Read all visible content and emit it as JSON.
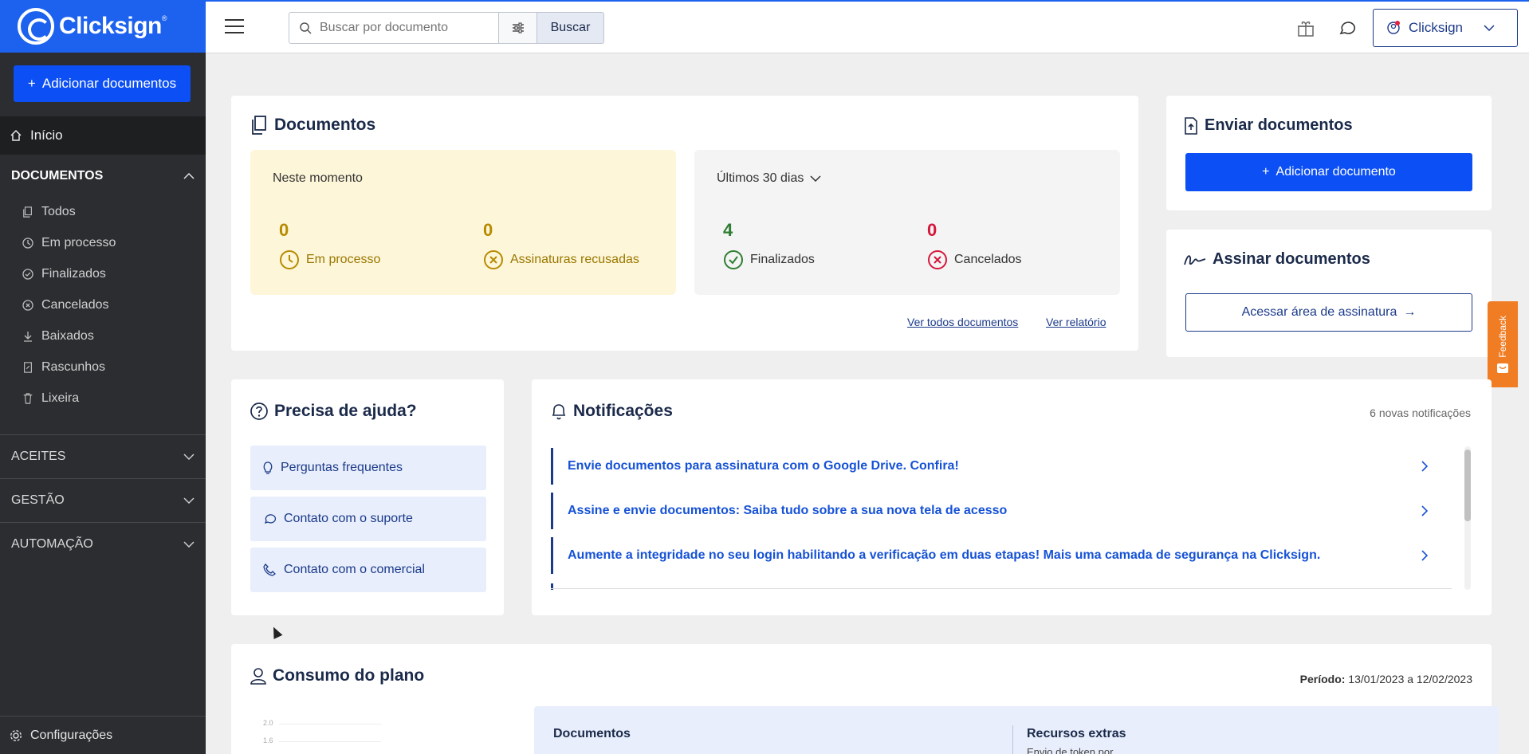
{
  "app": {
    "brand": "Clicksign",
    "brand_tm": "®"
  },
  "sidebar": {
    "add_button": "Adicionar documentos",
    "inicio": "Início",
    "documentos_header": "DOCUMENTOS",
    "doc_items": [
      {
        "label": "Todos",
        "icon": "documents-icon"
      },
      {
        "label": "Em processo",
        "icon": "clock-icon"
      },
      {
        "label": "Finalizados",
        "icon": "check-circle-icon"
      },
      {
        "label": "Cancelados",
        "icon": "x-circle-icon"
      },
      {
        "label": "Baixados",
        "icon": "download-icon"
      },
      {
        "label": "Rascunhos",
        "icon": "draft-icon"
      },
      {
        "label": "Lixeira",
        "icon": "trash-icon"
      }
    ],
    "sections": [
      "ACEITES",
      "GESTÃO",
      "AUTOMAÇÃO"
    ],
    "config": "Configurações"
  },
  "topbar": {
    "search_placeholder": "Buscar por documento",
    "search_button": "Buscar",
    "account_label": "Clicksign"
  },
  "documentos": {
    "title": "Documentos",
    "now_label": "Neste momento",
    "now_stats": [
      {
        "value": "0",
        "label": "Em processo"
      },
      {
        "value": "0",
        "label": "Assinaturas recusadas"
      }
    ],
    "period_label": "Últimos 30 dias",
    "period_stats": [
      {
        "value": "4",
        "label": "Finalizados"
      },
      {
        "value": "0",
        "label": "Cancelados"
      }
    ],
    "link_all": "Ver todos documentos",
    "link_report": "Ver relatório"
  },
  "enviar": {
    "title": "Enviar documentos",
    "button": "Adicionar documento"
  },
  "assinar": {
    "title": "Assinar documentos",
    "button": "Acessar área de assinatura"
  },
  "ajuda": {
    "title": "Precisa de ajuda?",
    "items": [
      "Perguntas frequentes",
      "Contato com o suporte",
      "Contato com o comercial"
    ]
  },
  "notificacoes": {
    "title": "Notificações",
    "count": "6 novas notificações",
    "items": [
      "Envie documentos para assinatura com o Google Drive. Confira!",
      "Assine e envie documentos: Saiba tudo sobre a sua nova tela de acesso",
      "Aumente a integridade no seu login habilitando a verificação em duas etapas! Mais uma camada de segurança na Clicksign."
    ]
  },
  "consumo": {
    "title": "Consumo do plano",
    "periodo_label": "Período:",
    "periodo_value": "13/01/2023 a 12/02/2023",
    "col_documentos": "Documentos",
    "col_recursos": "Recursos extras",
    "recursos_sub": "Envio de token por",
    "axis_ticks": [
      "2.0",
      "1.6"
    ]
  },
  "feedback": {
    "label": "Feedback"
  },
  "colors": {
    "brand_blue": "#1c62ef",
    "primary": "#0b4ff5",
    "sidebar": "#2b2d30",
    "warning": "#b78a00",
    "success": "#2e7d32",
    "danger": "#d5173c"
  }
}
